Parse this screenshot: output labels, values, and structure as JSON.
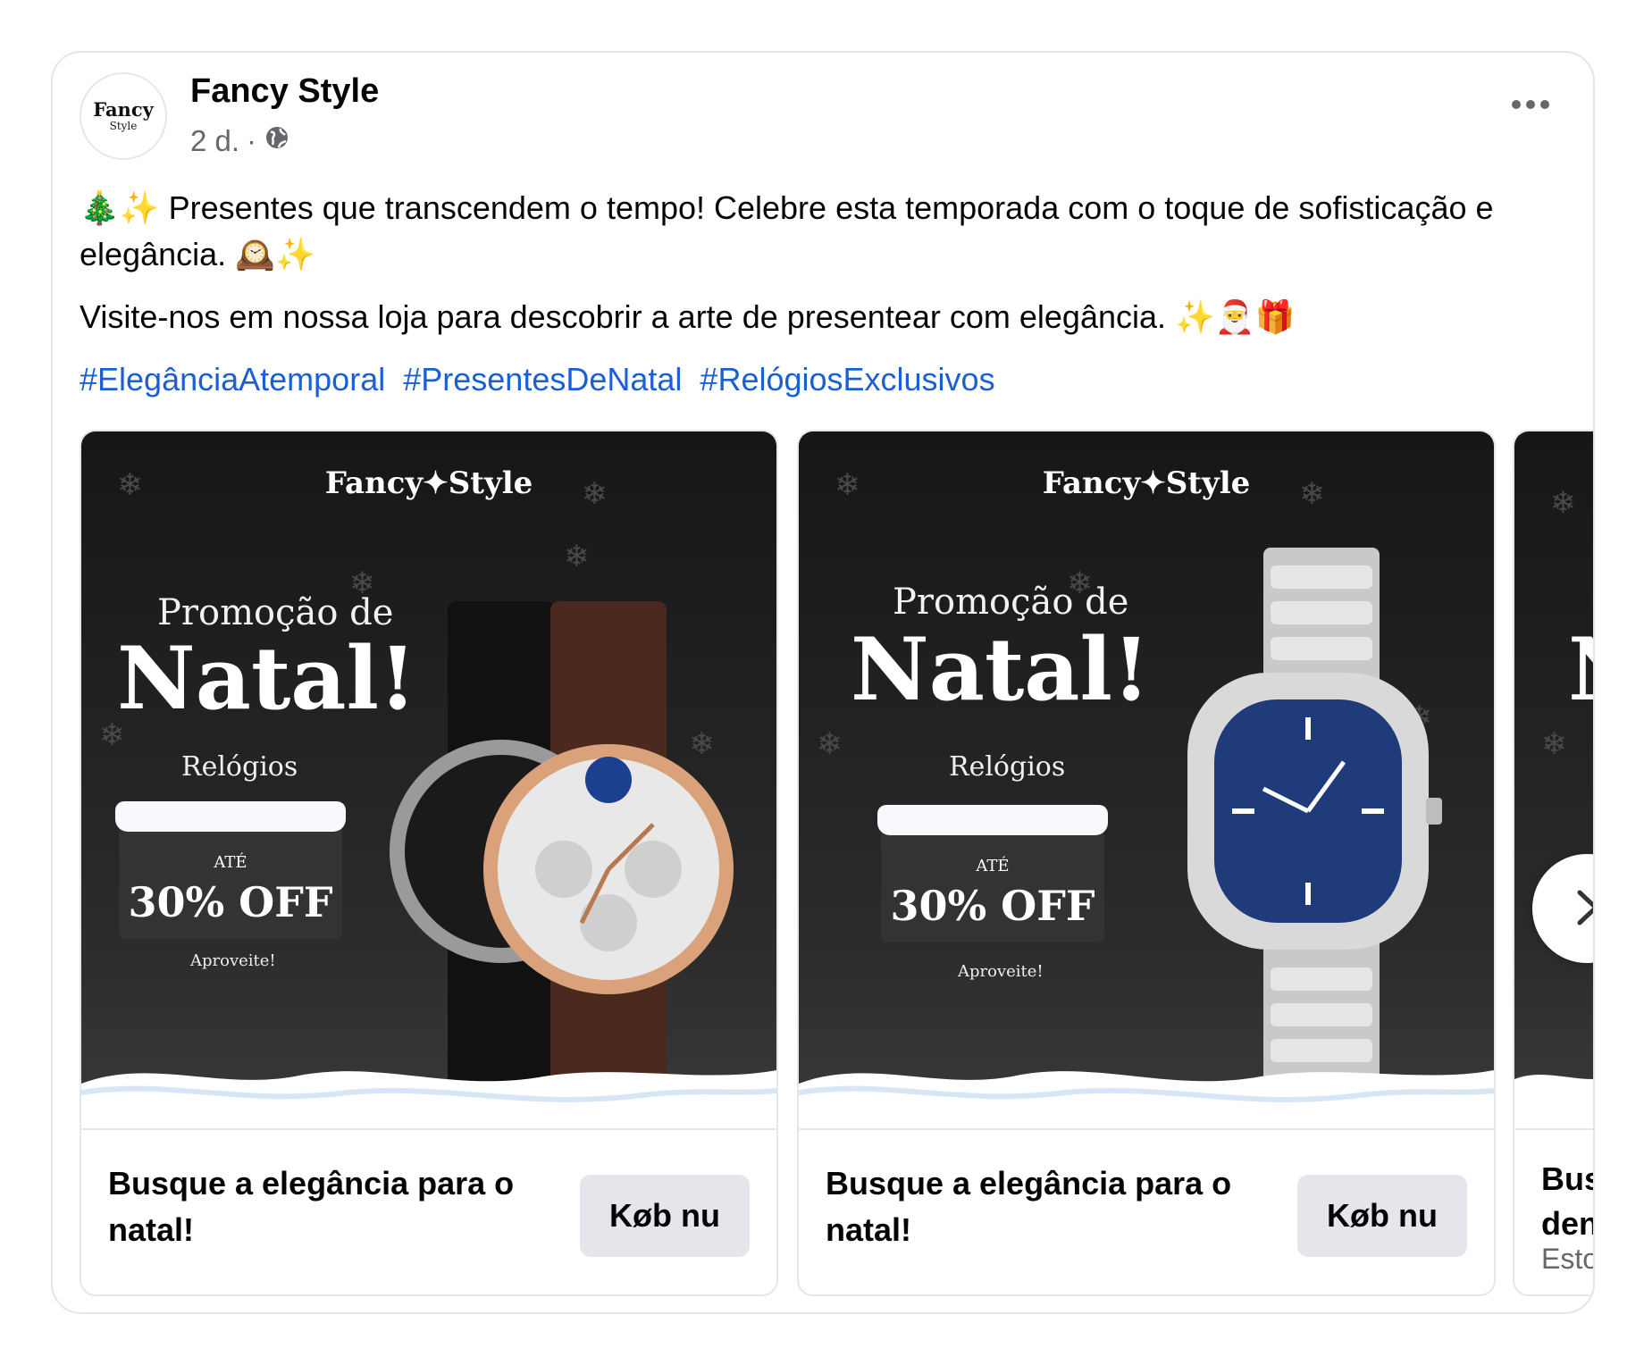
{
  "post": {
    "page_name": "Fancy Style",
    "avatar_text_1": "Fancy",
    "avatar_text_2": "Style",
    "time": "2 d.",
    "separator": "·",
    "paragraph1": "🎄✨ Presentes que transcendem o tempo! Celebre esta temporada com o toque de sofisticação e elegância. 🕰️✨",
    "paragraph2": "Visite-nos em nossa loja para descobrir a arte de presentear com elegância. ✨🎅🎁",
    "hashtags": [
      "#ElegânciaAtemporal",
      "#PresentesDeNatal",
      "#RelógiosExclusivos"
    ]
  },
  "carousel": [
    {
      "brand": "Fancy✦Style",
      "promo_line1": "Promoção de",
      "promo_line2": "Natal!",
      "category": "Relógios",
      "ate": "ATÉ",
      "discount": "30% OFF",
      "aproveite": "Aproveite!",
      "title": "Busque a elegância para o natal!",
      "cta": "Køb nu"
    },
    {
      "brand": "Fancy✦Style",
      "promo_line1": "Promoção de",
      "promo_line2": "Natal!",
      "category": "Relógios",
      "ate": "ATÉ",
      "discount": "30% OFF",
      "aproveite": "Aproveite!",
      "title": "Busque a elegância para o natal!",
      "cta": "Køb nu"
    },
    {
      "promo_fragment": "N",
      "title_fragment_1": "Bus",
      "title_fragment_2": "den",
      "subtitle_fragment": "Esto"
    }
  ],
  "colors": {
    "hashtag": "#1a5fd6",
    "button_bg": "#e4e6eb",
    "banner_bg": "#1c1c1c"
  },
  "icons": [
    "globe-icon",
    "more-options-icon",
    "chevron-right-icon"
  ]
}
